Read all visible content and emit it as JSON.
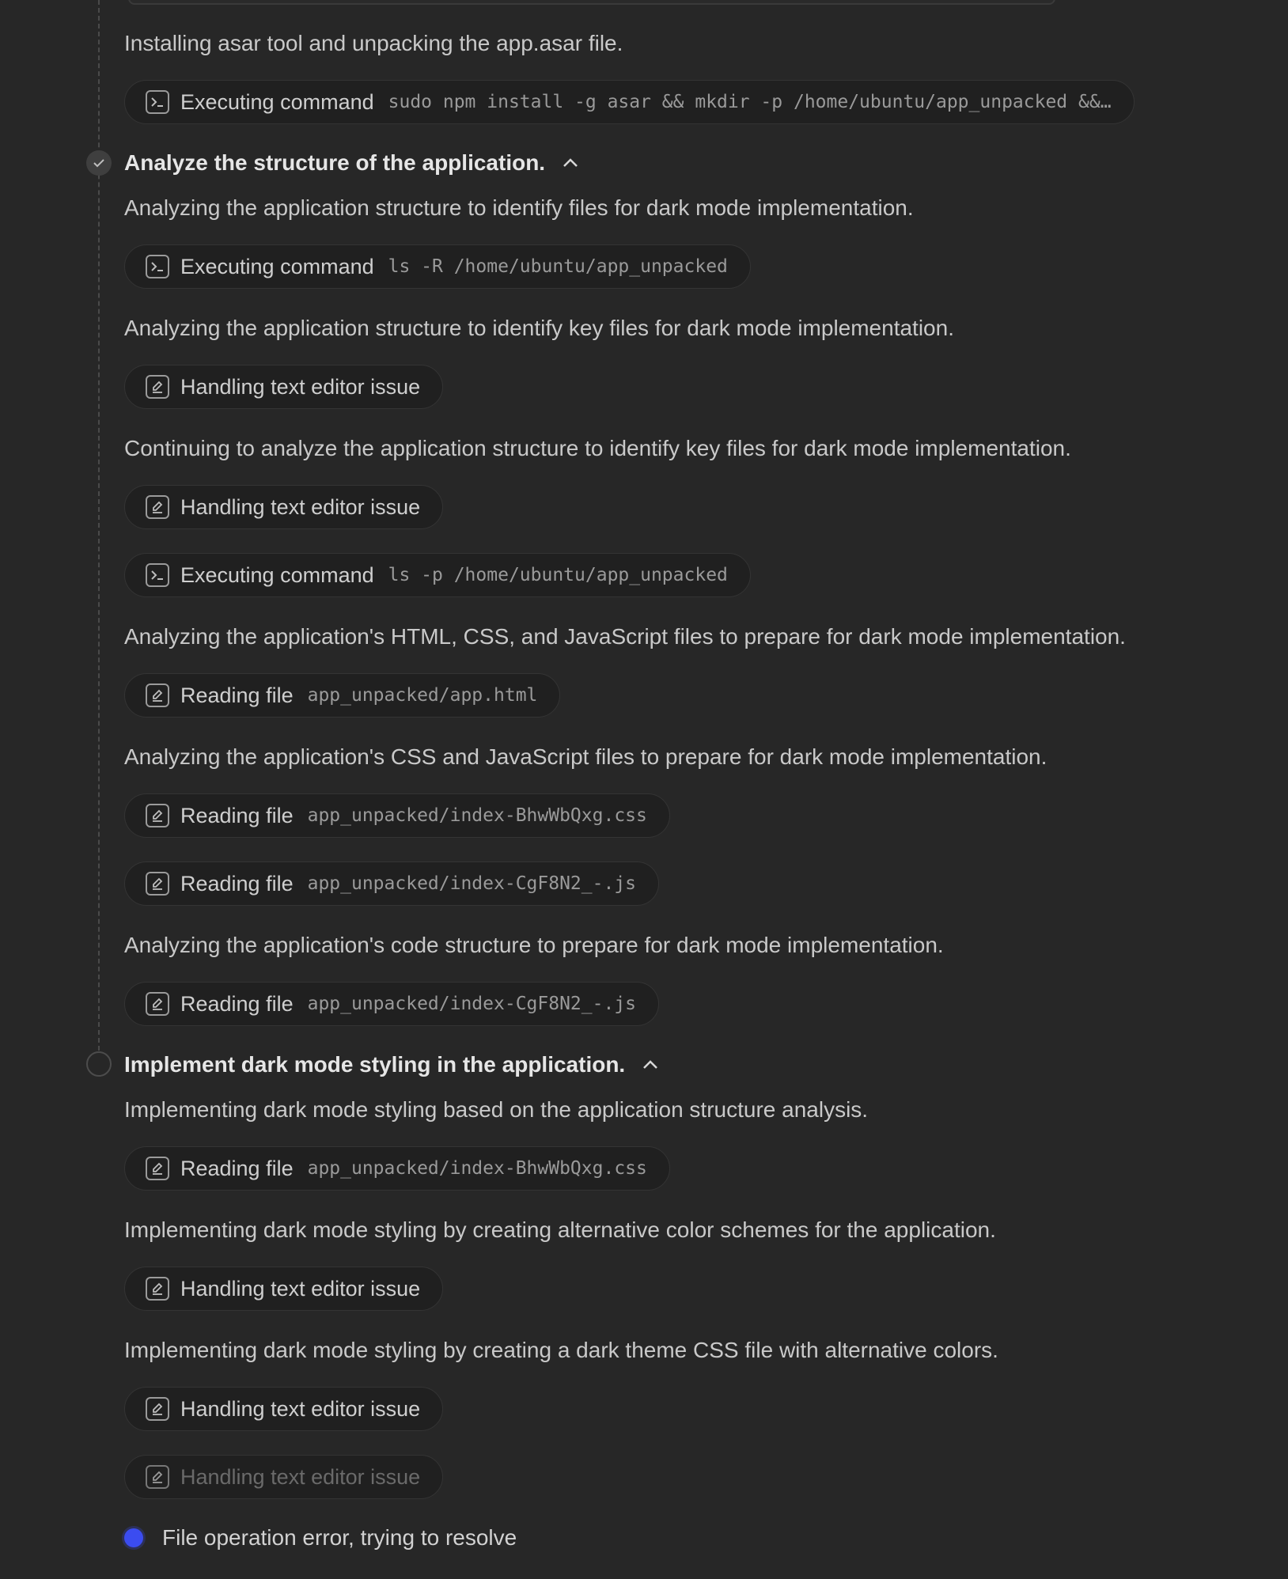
{
  "log": {
    "intro_text": "Installing asar tool and unpacking the app.asar file.",
    "intro_action": {
      "label": "Executing command",
      "arg": "sudo npm install -g asar && mkdir -p /home/ubuntu/app_unpacked &&…",
      "icon": "terminal-icon"
    }
  },
  "steps": [
    {
      "title": "Analyze the structure of the application.",
      "status": "done",
      "entries": [
        {
          "text": "Analyzing the application structure to identify files for dark mode implementation."
        },
        {
          "label": "Executing command",
          "arg": "ls -R /home/ubuntu/app_unpacked",
          "icon": "terminal-icon"
        },
        {
          "text": "Analyzing the application structure to identify key files for dark mode implementation."
        },
        {
          "label": "Handling text editor issue",
          "arg": "",
          "icon": "edit-icon"
        },
        {
          "text": "Continuing to analyze the application structure to identify key files for dark mode implementation."
        },
        {
          "label": "Handling text editor issue",
          "arg": "",
          "icon": "edit-icon"
        },
        {
          "label": "Executing command",
          "arg": "ls -p /home/ubuntu/app_unpacked",
          "icon": "terminal-icon"
        },
        {
          "text": "Analyzing the application's HTML, CSS, and JavaScript files to prepare for dark mode implementation."
        },
        {
          "label": "Reading file",
          "arg": "app_unpacked/app.html",
          "icon": "edit-icon"
        },
        {
          "text": "Analyzing the application's CSS and JavaScript files to prepare for dark mode implementation."
        },
        {
          "label": "Reading file",
          "arg": "app_unpacked/index-BhwWbQxg.css",
          "icon": "edit-icon"
        },
        {
          "label": "Reading file",
          "arg": "app_unpacked/index-CgF8N2_-.js",
          "icon": "edit-icon"
        },
        {
          "text": "Analyzing the application's code structure to prepare for dark mode implementation."
        },
        {
          "label": "Reading file",
          "arg": "app_unpacked/index-CgF8N2_-.js",
          "icon": "edit-icon"
        }
      ]
    },
    {
      "title": "Implement dark mode styling in the application.",
      "status": "in-progress",
      "entries": [
        {
          "text": "Implementing dark mode styling based on the application structure analysis."
        },
        {
          "label": "Reading file",
          "arg": "app_unpacked/index-BhwWbQxg.css",
          "icon": "edit-icon"
        },
        {
          "text": "Implementing dark mode styling by creating alternative color schemes for the application."
        },
        {
          "label": "Handling text editor issue",
          "arg": "",
          "icon": "edit-icon"
        },
        {
          "text": "Implementing dark mode styling by creating a dark theme CSS file with alternative colors."
        },
        {
          "label": "Handling text editor issue",
          "arg": "",
          "icon": "edit-icon"
        },
        {
          "label": "Handling text editor issue",
          "arg": "",
          "icon": "edit-icon"
        }
      ]
    }
  ],
  "status": {
    "text": "File operation error, trying to resolve",
    "dot_color": "#3b4cf0"
  },
  "colors": {
    "background": "#272727",
    "pill_background": "#202020",
    "text": "#c9c9c9",
    "accent_blue": "#3b4cf0"
  }
}
